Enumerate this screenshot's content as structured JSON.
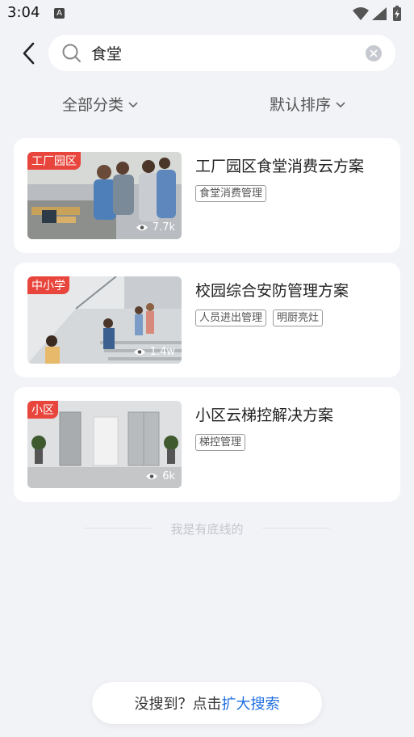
{
  "status_bar": {
    "time": "3:04",
    "notif_letter": "A"
  },
  "search": {
    "query": "食堂",
    "placeholder": ""
  },
  "filters": {
    "category_label": "全部分类",
    "sort_label": "默认排序"
  },
  "results": [
    {
      "badge": "工厂园区",
      "views": "7.7k",
      "title": "工厂园区食堂消费云方案",
      "tags": [
        "食堂消费管理"
      ]
    },
    {
      "badge": "中小学",
      "views": "1.4w",
      "title": "校园综合安防管理方案",
      "tags": [
        "人员进出管理",
        "明厨亮灶"
      ]
    },
    {
      "badge": "小区",
      "views": "6k",
      "title": "小区云梯控解决方案",
      "tags": [
        "梯控管理"
      ]
    }
  ],
  "end_of_list": "我是有底线的",
  "bottom_prompt": {
    "prefix": "没搜到？点击",
    "link": "扩大搜索"
  },
  "colors": {
    "accent": "#1f6fe0",
    "badge": "#e8453c",
    "background": "#f2f3f7"
  },
  "icons": [
    "wifi-icon",
    "signal-icon",
    "battery-icon",
    "back-arrow-icon",
    "search-icon",
    "clear-icon",
    "chevron-down-icon",
    "eye-icon"
  ]
}
